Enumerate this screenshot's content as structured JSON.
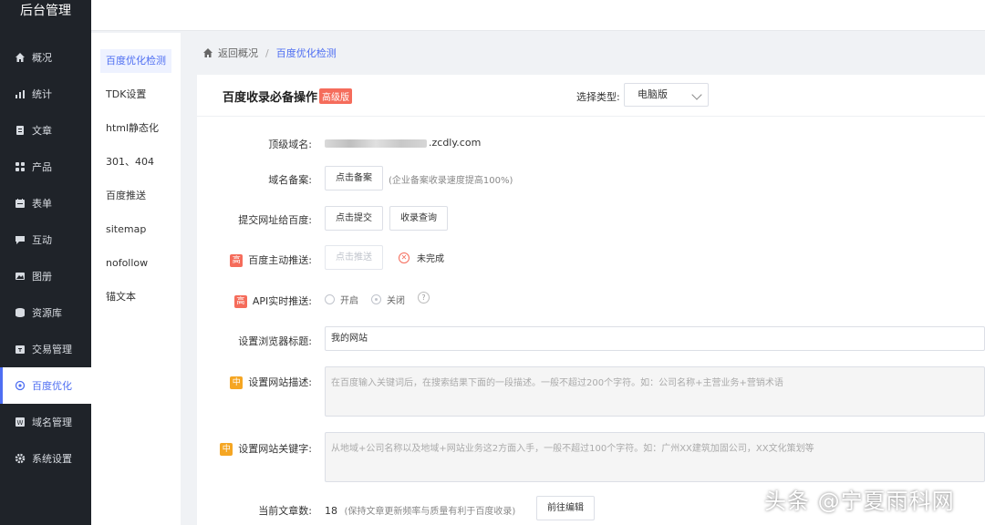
{
  "app": {
    "title": "后台管理"
  },
  "sidebar": {
    "items": [
      {
        "label": "概况",
        "icon": "home-icon"
      },
      {
        "label": "统计",
        "icon": "chart-icon"
      },
      {
        "label": "文章",
        "icon": "article-icon"
      },
      {
        "label": "产品",
        "icon": "grid-icon"
      },
      {
        "label": "表单",
        "icon": "calendar-form-icon"
      },
      {
        "label": "互动",
        "icon": "chat-icon"
      },
      {
        "label": "图册",
        "icon": "album-icon"
      },
      {
        "label": "资源库",
        "icon": "database-icon"
      },
      {
        "label": "交易管理",
        "icon": "trade-icon"
      },
      {
        "label": "百度优化",
        "icon": "seo-icon",
        "active": true
      },
      {
        "label": "域名管理",
        "icon": "domain-icon"
      },
      {
        "label": "系统设置",
        "icon": "gear-icon"
      }
    ]
  },
  "subnav": {
    "items": [
      "百度优化检测",
      "TDK设置",
      "html静态化",
      "301、404",
      "百度推送",
      "sitemap",
      "nofollow",
      "锚文本"
    ],
    "active_index": 0
  },
  "breadcrumb": {
    "back": "返回概况",
    "separator": "/",
    "current": "百度优化检测"
  },
  "panel": {
    "title": "百度收录必备操作",
    "tag": "高级版",
    "type_label": "选择类型:",
    "type_value": "电脑版"
  },
  "form": {
    "domain": {
      "label": "顶级域名:",
      "value_suffix": ".zcdly.com"
    },
    "record": {
      "label": "域名备案:",
      "button": "点击备案",
      "hint": "(企业备案收录速度提高100%)"
    },
    "submit_url": {
      "label": "提交网址给百度:",
      "button1": "点击提交",
      "button2": "收录查询"
    },
    "active_push": {
      "badge": "高",
      "label": "百度主动推送:",
      "button": "点击推送",
      "status": "未完成"
    },
    "api_push": {
      "badge": "高",
      "label": "API实时推送:",
      "option_on": "开启",
      "option_off": "关闭",
      "help": "?"
    },
    "browser_title": {
      "label": "设置浏览器标题:",
      "value": "我的网站"
    },
    "site_desc": {
      "badge": "中",
      "label": "设置网站描述:",
      "placeholder": "在百度输入关键词后，在搜索结果下面的一段描述。一般不超过200个字符。如：公司名称+主营业务+营销术语"
    },
    "site_keywords": {
      "badge": "中",
      "label": "设置网站关键字:",
      "placeholder": "从地域+公司名称以及地域+网站业务这2方面入手，一般不超过100个字符。如：广州XX建筑加固公司，XX文化策划等"
    },
    "article_count": {
      "label": "当前文章数:",
      "value": "18",
      "hint": "(保持文章更新频率与质量有利于百度收录)",
      "button": "前往编辑"
    }
  },
  "watermark": "头条 @宁夏雨科网",
  "colors": {
    "sidebar_bg": "#1f2329",
    "accent": "#4e6ef2",
    "high_badge": "#f56c5b",
    "mid_badge": "#f5a623"
  }
}
